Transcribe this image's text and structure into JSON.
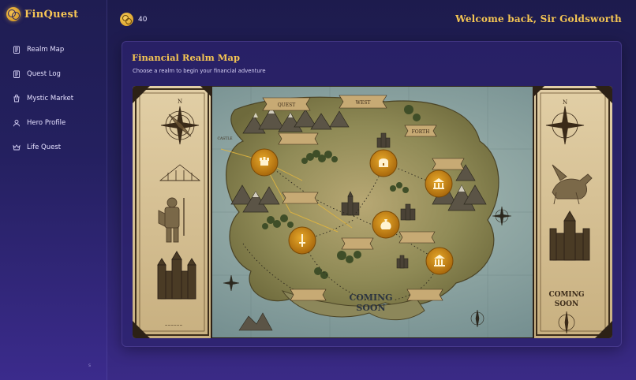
{
  "app": {
    "title": "FinQuest",
    "logo_icon": "coins-icon"
  },
  "sidebar": {
    "items": [
      {
        "label": "Realm Map",
        "icon": "scroll-map-icon"
      },
      {
        "label": "Quest Log",
        "icon": "scroll-icon"
      },
      {
        "label": "Mystic Market",
        "icon": "bag-icon"
      },
      {
        "label": "Hero Profile",
        "icon": "user-icon"
      },
      {
        "label": "Life Quest",
        "icon": "crown-icon"
      }
    ],
    "footer_mark": "s"
  },
  "header": {
    "coins": "40",
    "coin_icon": "coins-icon",
    "welcome": "Welcome back, Sir Goldsworth"
  },
  "main": {
    "title": "Financial Realm Map",
    "subtitle": "Choose a realm to begin your financial adventure",
    "map": {
      "coming_soon_left": [
        "COMING",
        "SOON"
      ],
      "coming_soon_right": [
        "COMING",
        "SOON"
      ],
      "banners": [
        "QUEST",
        "WEST",
        "FORTH",
        "CASTLE"
      ],
      "realm_markers": [
        {
          "name": "realm-marker-1",
          "icon": "castle-icon"
        },
        {
          "name": "realm-marker-2",
          "icon": "treasure-icon"
        },
        {
          "name": "realm-marker-3",
          "icon": "bank-icon"
        },
        {
          "name": "realm-marker-4",
          "icon": "money-bag-icon"
        },
        {
          "name": "realm-marker-5",
          "icon": "sword-icon"
        },
        {
          "name": "realm-marker-6",
          "icon": "temple-icon"
        }
      ]
    }
  },
  "colors": {
    "accent_gold": "#f4c553",
    "sidebar_bg": "#1f1d52",
    "card_bg": "#2c226e",
    "parchment": "#d9c49a",
    "sea": "#8fa8a7"
  }
}
